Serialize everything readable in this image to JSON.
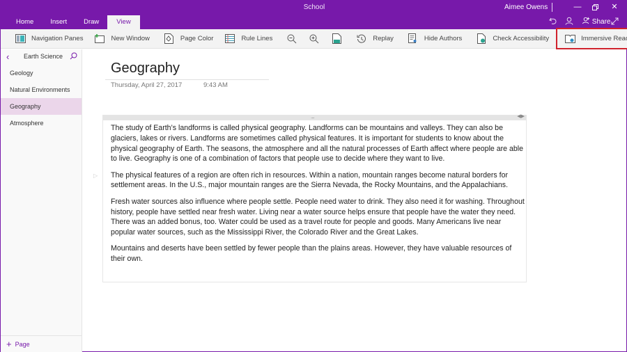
{
  "window": {
    "title": "School",
    "user": "Aimee Owens",
    "minimize_icon": "minimize-icon",
    "restore_icon": "restore-icon",
    "close_icon": "close-icon",
    "share_label": "Share"
  },
  "tabs": [
    {
      "label": "Home"
    },
    {
      "label": "Insert"
    },
    {
      "label": "Draw"
    },
    {
      "label": "View",
      "active": true
    }
  ],
  "ribbon": {
    "navigation_panes": "Navigation Panes",
    "new_window": "New Window",
    "page_color": "Page Color",
    "rule_lines": "Rule Lines",
    "replay": "Replay",
    "hide_authors": "Hide Authors",
    "check_accessibility": "Check Accessibility",
    "immersive_reader": "Immersive Reader"
  },
  "sidebar": {
    "section": "Earth Science",
    "pages": [
      {
        "label": "Geology"
      },
      {
        "label": "Natural Environments"
      },
      {
        "label": "Geography",
        "selected": true
      },
      {
        "label": "Atmosphere"
      }
    ],
    "add_page": "Page"
  },
  "page": {
    "title": "Geography",
    "date": "Thursday, April 27, 2017",
    "time": "9:43 AM",
    "paragraphs": [
      "The study of Earth’s landforms is called physical geography. Landforms can be mountains and valleys. They can also be glaciers, lakes or rivers. Landforms are sometimes called physical features. It is important for students to know about the physical geography of Earth. The seasons, the atmosphere and all the natural processes of Earth affect where people are able to live. Geography is one of a combination of factors that people use to decide where they want to live.",
      "The physical features of a region are often rich in resources. Within a nation, mountain ranges become natural borders for settlement areas. In the U.S., major mountain ranges are the Sierra Nevada, the Rocky Mountains, and the Appalachians.",
      "Fresh water sources also influence where people settle. People need water to drink. They also need it for washing. Throughout history, people have settled near fresh water. Living near a water source helps ensure that people have the water they need. There was an added bonus, too. Water could be used as a travel route for people and goods. Many Americans live near popular water sources, such as the Mississippi River, the Colorado River and the Great Lakes.",
      "Mountains and deserts have been settled by fewer people than the plains areas. However, they have valuable resources of their own."
    ]
  },
  "colors": {
    "brand": "#7719aa",
    "selected_page": "#ebd6ea",
    "highlight_box": "#d0222c"
  }
}
